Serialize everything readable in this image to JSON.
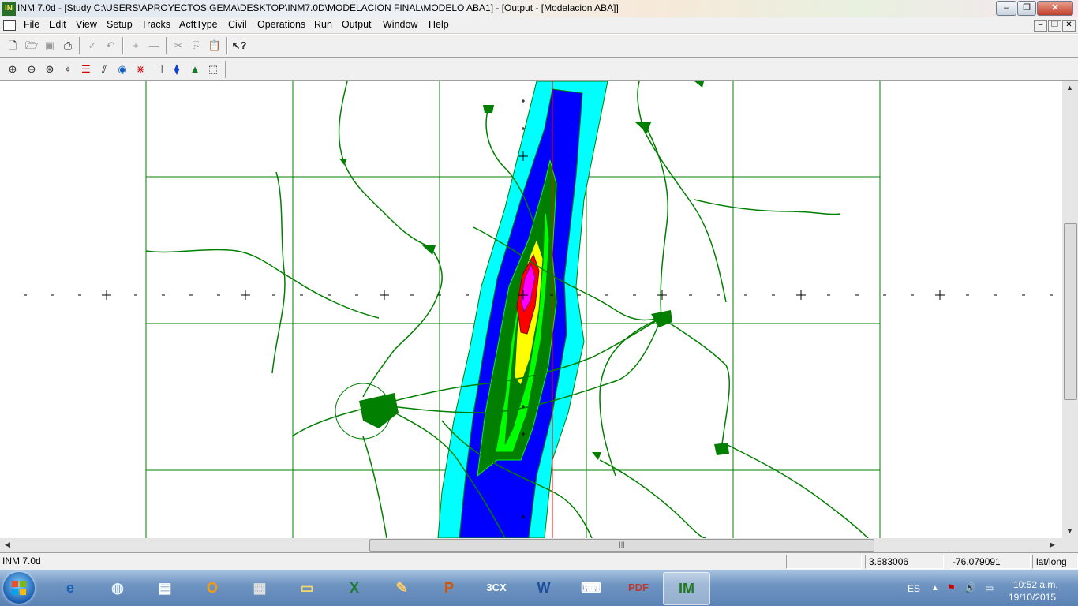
{
  "window": {
    "app_icon": "inm-icon",
    "title": "INM 7.0d  - [Study C:\\USERS\\APROYECTOS.GEMA\\DESKTOP\\INM7.0D\\MODELACION FINAL\\MODELO ABA1] - [Output - [Modelacion ABA]]"
  },
  "menu": {
    "items": [
      "File",
      "Edit",
      "View",
      "Setup",
      "Tracks",
      "AcftType",
      "Civil",
      "Operations",
      "Run",
      "Output",
      "Window",
      "Help"
    ]
  },
  "toolbar1": {
    "buttons": [
      "new-icon",
      "open-icon",
      "save-icon",
      "print-icon",
      "check-icon",
      "undo-icon",
      "add-icon",
      "remove-icon",
      "cut-icon",
      "copy-icon",
      "paste-icon",
      "help-pointer-icon"
    ]
  },
  "toolbar2": {
    "buttons": [
      "zoom-in-icon",
      "zoom-out-icon",
      "zoom-window-icon",
      "recenter-icon",
      "layers-icon",
      "tracks-icon",
      "contours-icon",
      "grid-points-icon",
      "runway-icon",
      "locations-icon",
      "terrain-icon",
      "bounds-icon"
    ]
  },
  "map": {
    "contour_colors": {
      "outer": "#00ffff",
      "ring2": "#0000ff",
      "ring3": "#007f00",
      "ring4": "#00ff00",
      "ring5": "#ffff00",
      "ring6": "#ff0000",
      "ring7": "#ff00ff",
      "roads": "#007f00"
    }
  },
  "status": {
    "app": "INM 7.0d",
    "field2": "",
    "lat": "3.583006",
    "long": "-76.079091",
    "units": "lat/long"
  },
  "taskbar": {
    "apps": [
      "Internet Explorer",
      "Google Earth",
      "Remote Desktop",
      "Outlook",
      "Calculator",
      "Explorer",
      "Excel",
      "Paint",
      "PowerPoint",
      "3CX",
      "Word",
      "Connect",
      "Adobe PDF",
      "INM"
    ],
    "lang": "ES",
    "time": "10:52 a.m.",
    "date": "19/10/2015"
  }
}
